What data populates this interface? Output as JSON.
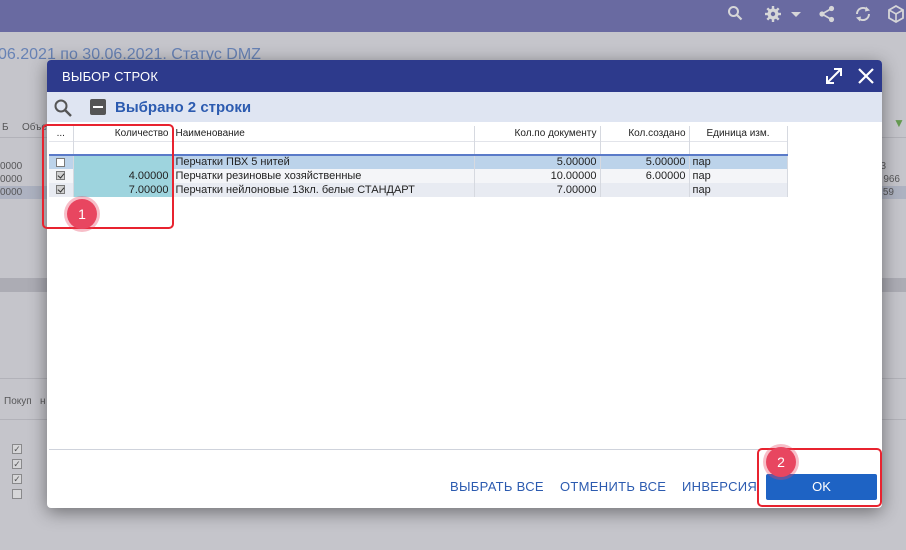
{
  "background": {
    "subtitle": "06.2021 по 30.06.2021. Статус DMZ",
    "header_cols": [
      "Б",
      "Объе"
    ],
    "rows": [
      {
        "id": "0000",
        "right": "3"
      },
      {
        "id": "0000",
        "right": "966"
      },
      {
        "id": "0000",
        "right": "59"
      }
    ],
    "lower_header": [
      "Покуп",
      "н"
    ]
  },
  "dialog": {
    "title": "ВЫБОР СТРОК",
    "selected_text": "Выбрано 2 строки",
    "columns": {
      "select": "...",
      "qty": "Количество",
      "name": "Наименование",
      "doc_qty": "Кол.по документу",
      "created": "Кол.создано",
      "unit": "Единица изм."
    },
    "rows": [
      {
        "checked": false,
        "qty": "",
        "name": "Перчатки ПВХ 5 нитей",
        "doc_qty": "5.00000",
        "created": "5.00000",
        "unit": "пар"
      },
      {
        "checked": true,
        "qty": "4.00000",
        "name": "Перчатки резиновые хозяйственные",
        "doc_qty": "10.00000",
        "created": "6.00000",
        "unit": "пар"
      },
      {
        "checked": true,
        "qty": "7.00000",
        "name": "Перчатки нейлоновые 13кл. белые СТАНДАРТ",
        "doc_qty": "7.00000",
        "created": "",
        "unit": "пар"
      }
    ],
    "footer": {
      "select_all": "ВЫБРАТЬ ВСЕ",
      "cancel_all": "ОТМЕНИТЬ ВСЕ",
      "invert": "ИНВЕРСИЯ",
      "ok": "OK"
    }
  },
  "annotations": {
    "badge1": "1",
    "badge2": "2"
  },
  "colors": {
    "header_bg": "#2d3a8c",
    "accent": "#1e63c4",
    "annotation": "#e8232f",
    "topbar": "#6e6fb6"
  }
}
